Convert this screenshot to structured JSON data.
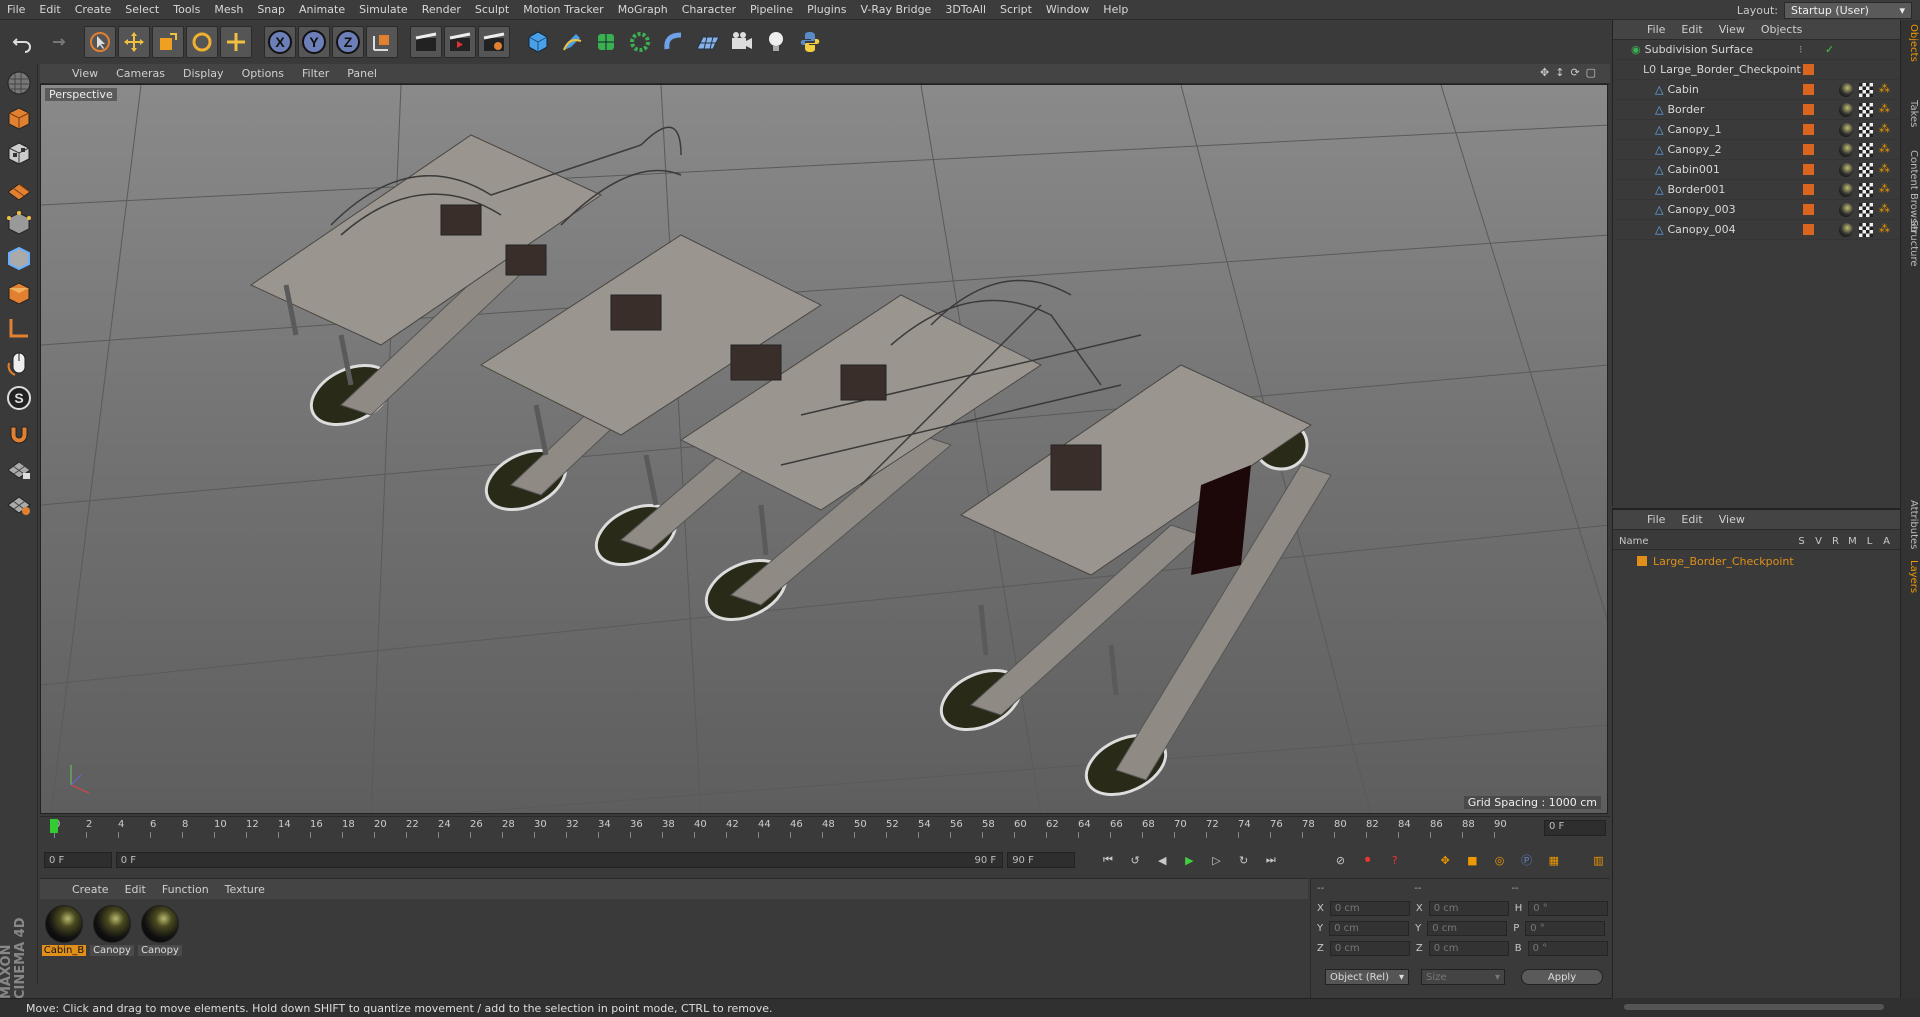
{
  "menubar": {
    "items": [
      "File",
      "Edit",
      "Create",
      "Select",
      "Tools",
      "Mesh",
      "Snap",
      "Animate",
      "Simulate",
      "Render",
      "Sculpt",
      "Motion Tracker",
      "MoGraph",
      "Character",
      "Pipeline",
      "Plugins",
      "V-Ray Bridge",
      "3DToAll",
      "Script",
      "Window",
      "Help"
    ],
    "layout_label": "Layout:",
    "layout_value": "Startup (User)"
  },
  "viewport": {
    "menu": [
      "View",
      "Cameras",
      "Display",
      "Options",
      "Filter",
      "Panel"
    ],
    "label": "Perspective",
    "grid_spacing": "Grid Spacing : 1000 cm"
  },
  "timeline": {
    "ticks": [
      "0",
      "2",
      "4",
      "6",
      "8",
      "10",
      "12",
      "14",
      "16",
      "18",
      "20",
      "22",
      "24",
      "26",
      "28",
      "30",
      "32",
      "34",
      "36",
      "38",
      "40",
      "42",
      "44",
      "46",
      "48",
      "50",
      "52",
      "54",
      "56",
      "58",
      "60",
      "62",
      "64",
      "66",
      "68",
      "70",
      "72",
      "74",
      "76",
      "78",
      "80",
      "82",
      "84",
      "86",
      "88",
      "90"
    ],
    "end_frame": "0 F",
    "current_frame": "0 F",
    "range_start": "0 F",
    "range_end": "90 F",
    "max_frame": "90 F"
  },
  "material_panel": {
    "menu": [
      "Create",
      "Edit",
      "Function",
      "Texture"
    ],
    "materials": [
      {
        "label": "Cabin_B",
        "active": true
      },
      {
        "label": "Canopy",
        "active": false
      },
      {
        "label": "Canopy",
        "active": false
      }
    ],
    "brand": "MAXON CINEMA 4D"
  },
  "coord_panel": {
    "headers": [
      "--",
      "--",
      "--"
    ],
    "rows": [
      {
        "a": "X",
        "av": "0 cm",
        "b": "X",
        "bv": "0 cm",
        "c": "H",
        "cv": "0 °"
      },
      {
        "a": "Y",
        "av": "0 cm",
        "b": "Y",
        "bv": "0 cm",
        "c": "P",
        "cv": "0 °"
      },
      {
        "a": "Z",
        "av": "0 cm",
        "b": "Z",
        "bv": "0 cm",
        "c": "B",
        "cv": "0 °"
      }
    ],
    "mode": "Object (Rel)",
    "size": "Size",
    "apply": "Apply"
  },
  "status": "Move: Click and drag to move elements. Hold down SHIFT to quantize movement / add to the selection in point mode, CTRL to remove.",
  "object_panel": {
    "menu": [
      "File",
      "Edit",
      "View",
      "Objects"
    ],
    "root": "Subdivision Surface",
    "group": "Large_Border_Checkpoint",
    "children": [
      "Cabin",
      "Border",
      "Canopy_1",
      "Canopy_2",
      "Cabin001",
      "Border001",
      "Canopy_003",
      "Canopy_004"
    ]
  },
  "layer_panel": {
    "menu": [
      "File",
      "Edit",
      "View"
    ],
    "columns": [
      "Name",
      "S",
      "V",
      "R",
      "M",
      "L",
      "A"
    ],
    "layer": "Large_Border_Checkpoint",
    "layer_color": "#e0901a"
  },
  "right_tabs": [
    "Objects",
    "Takes",
    "Content Browser",
    "Structure",
    "Attributes",
    "Layers"
  ],
  "colors": {
    "accent": "#e0901a",
    "swatch": "#d9651e"
  }
}
